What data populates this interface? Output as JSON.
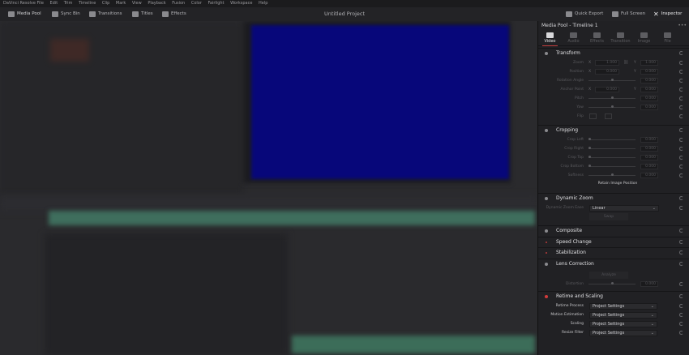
{
  "menubar": {
    "app_name": "DaVinci Resolve",
    "items": [
      "File",
      "Edit",
      "Trim",
      "Timeline",
      "Clip",
      "Mark",
      "View",
      "Playback",
      "Fusion",
      "Color",
      "Fairlight",
      "Workspace",
      "Help"
    ]
  },
  "toolbar": {
    "media_pool": "Media Pool",
    "sync_bin": "Sync Bin",
    "transitions": "Transitions",
    "titles": "Titles",
    "effects": "Effects",
    "project_title": "Untitled Project",
    "quick_export": "Quick Export",
    "full_screen": "Full Screen",
    "inspector": "Inspector"
  },
  "inspector": {
    "title": "Media Pool - Timeline 1",
    "menu_icon": "more-dots-icon",
    "tabs": [
      {
        "label": "Video",
        "icon": "film-icon",
        "active": true
      },
      {
        "label": "Audio",
        "icon": "music-note-icon",
        "active": false
      },
      {
        "label": "Effects",
        "icon": "wand-icon",
        "active": false
      },
      {
        "label": "Transition",
        "icon": "transition-icon",
        "active": false
      },
      {
        "label": "Image",
        "icon": "image-icon",
        "active": false
      },
      {
        "label": "File",
        "icon": "file-icon",
        "active": false
      }
    ],
    "transform": {
      "title": "Transform",
      "rows": [
        {
          "label": "Zoom",
          "x": "1.000",
          "y": "1.000"
        },
        {
          "label": "Position",
          "x": "0.000",
          "y": "0.000"
        },
        {
          "label": "Rotation Angle",
          "value": "0.000"
        },
        {
          "label": "Anchor Point",
          "x": "0.000",
          "y": "0.000"
        },
        {
          "label": "Pitch",
          "value": "0.000"
        },
        {
          "label": "Yaw",
          "value": "0.000"
        },
        {
          "label": "Flip"
        }
      ],
      "axis_x": "X",
      "axis_y": "Y"
    },
    "cropping": {
      "title": "Cropping",
      "rows": [
        {
          "label": "Crop Left",
          "value": "0.000"
        },
        {
          "label": "Crop Right",
          "value": "0.000"
        },
        {
          "label": "Crop Top",
          "value": "0.000"
        },
        {
          "label": "Crop Bottom",
          "value": "0.000"
        },
        {
          "label": "Softness",
          "value": "0.000"
        }
      ],
      "retain": "Retain Image Position"
    },
    "dynamic_zoom": {
      "title": "Dynamic Zoom",
      "ease_label": "Dynamic Zoom Ease",
      "ease_value": "Linear",
      "swap": "Swap"
    },
    "composite": {
      "title": "Composite"
    },
    "speed_change": {
      "title": "Speed Change"
    },
    "stabilization": {
      "title": "Stabilization"
    },
    "lens_correction": {
      "title": "Lens Correction",
      "analyze": "Analyze",
      "distortion_label": "Distortion",
      "distortion_value": "0.000"
    },
    "retime_scaling": {
      "title": "Retime and Scaling",
      "rows": [
        {
          "label": "Retime Process",
          "value": "Project Settings"
        },
        {
          "label": "Motion Estimation",
          "value": "Project Settings"
        },
        {
          "label": "Scaling",
          "value": "Project Settings"
        },
        {
          "label": "Resize Filter",
          "value": "Project Settings"
        }
      ]
    }
  }
}
